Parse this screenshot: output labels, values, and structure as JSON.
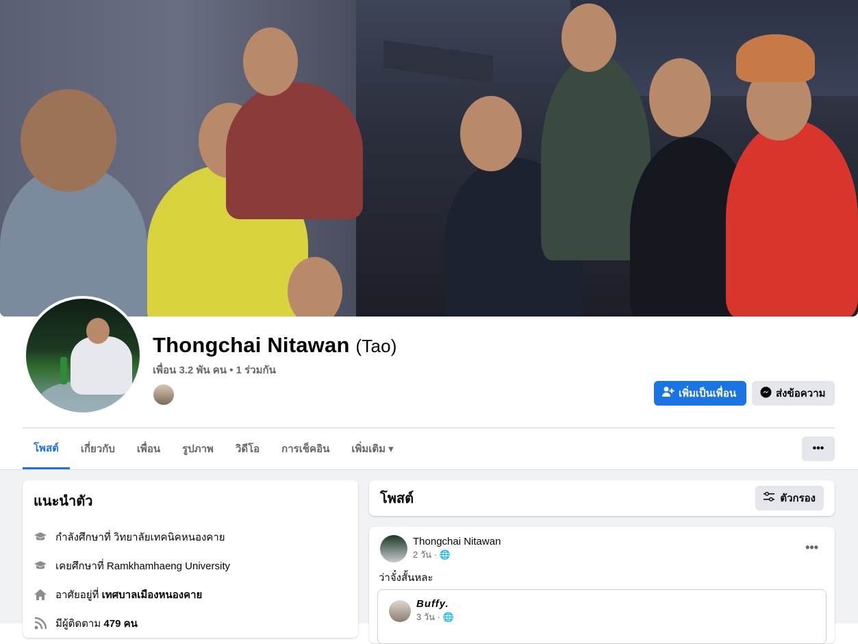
{
  "profile": {
    "name": "Thongchai Nitawan",
    "alt_name": "(Tao)",
    "friends_line": "เพื่อน 3.2 พัน คน • 1 ร่วมกัน"
  },
  "actions": {
    "add_friend": "เพิ่มเป็นเพื่อน",
    "message": "ส่งข้อความ",
    "more": "•••"
  },
  "tabs": [
    {
      "label": "โพสต์",
      "active": true
    },
    {
      "label": "เกี่ยวกับ"
    },
    {
      "label": "เพื่อน"
    },
    {
      "label": "รูปภาพ"
    },
    {
      "label": "วิดีโอ"
    },
    {
      "label": "การเช็คอิน"
    },
    {
      "label": "เพิ่มเติม ▾"
    }
  ],
  "intro": {
    "title": "แนะนำตัว",
    "rows": [
      {
        "icon": "graduation-cap-icon",
        "text": "กำลังศึกษาที่ วิทยาลัยเทคนิคหนองคาย"
      },
      {
        "icon": "graduation-cap-icon",
        "text": "เคยศึกษาที่ Ramkhamhaeng University"
      },
      {
        "icon": "home-icon",
        "text": "อาศัยอยู่ที่ ",
        "bold": "เทศบาลเมืองหนองคาย"
      },
      {
        "icon": "rss-icon",
        "text": "มีผู้ติดตาม ",
        "bold": "479 คน"
      }
    ]
  },
  "posts": {
    "title": "โพสต์",
    "filter_label": "ตัวกรอง"
  },
  "post": {
    "author": "Thongchai Nitawan",
    "meta": "2 วัน · 🌐",
    "text": "ว่าจั๋งสั้นหละ",
    "shared_author": "Buffy.",
    "shared_meta": "3 วัน · 🌐"
  },
  "colors": {
    "accent": "#1b74e4",
    "secondary_bg": "#e4e6eb",
    "feed_bg": "#f0f2f5"
  }
}
